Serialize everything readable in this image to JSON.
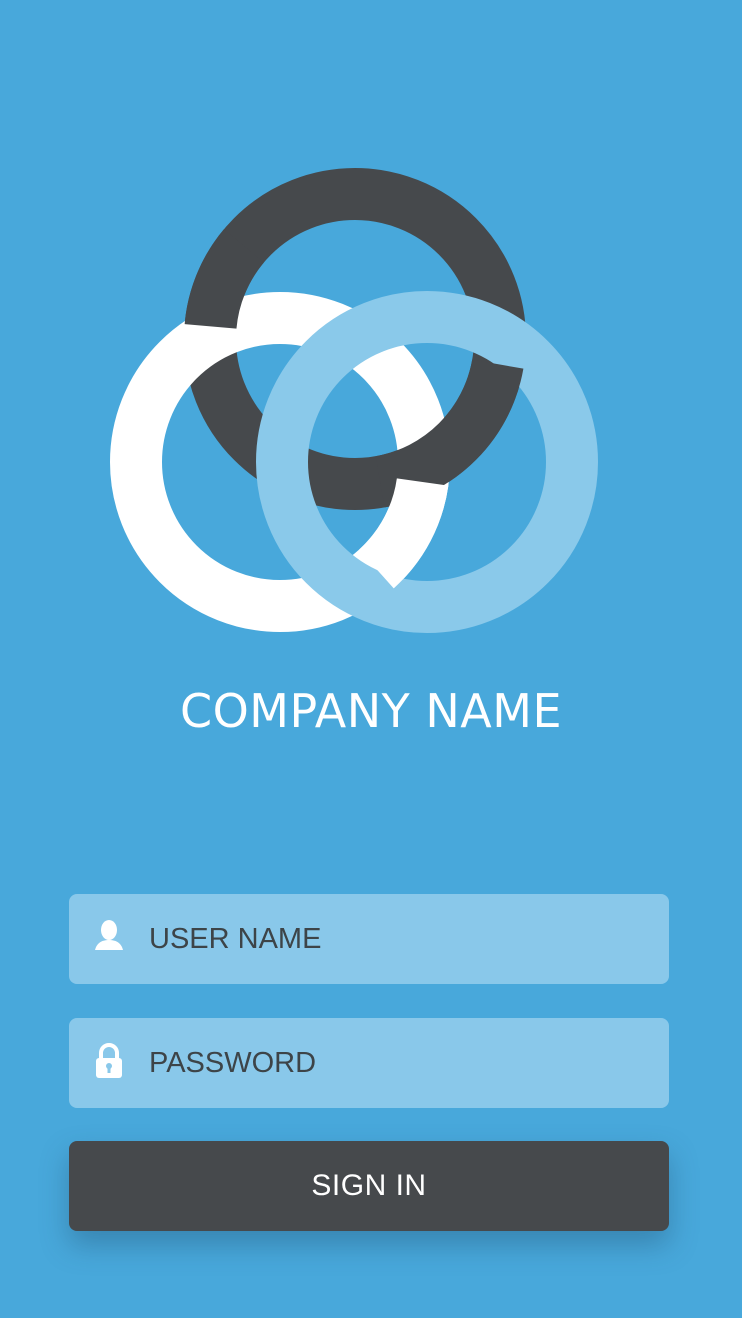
{
  "brand": {
    "company_name": "COMPANY NAME",
    "logo_name": "interlocking-rings-logo",
    "colors": {
      "background": "#48a8db",
      "ring_dark": "#46494c",
      "ring_white": "#ffffff",
      "ring_light": "#8ac9ea"
    }
  },
  "form": {
    "username": {
      "placeholder": "USER NAME",
      "value": "",
      "icon": "user-icon"
    },
    "password": {
      "placeholder": "PASSWORD",
      "value": "",
      "icon": "lock-icon"
    },
    "sign_in_label": "SIGN IN",
    "colors": {
      "field_background": "#89c8ea",
      "field_text": "#3d4448",
      "button_background": "#46494c",
      "button_text": "#ffffff"
    }
  }
}
